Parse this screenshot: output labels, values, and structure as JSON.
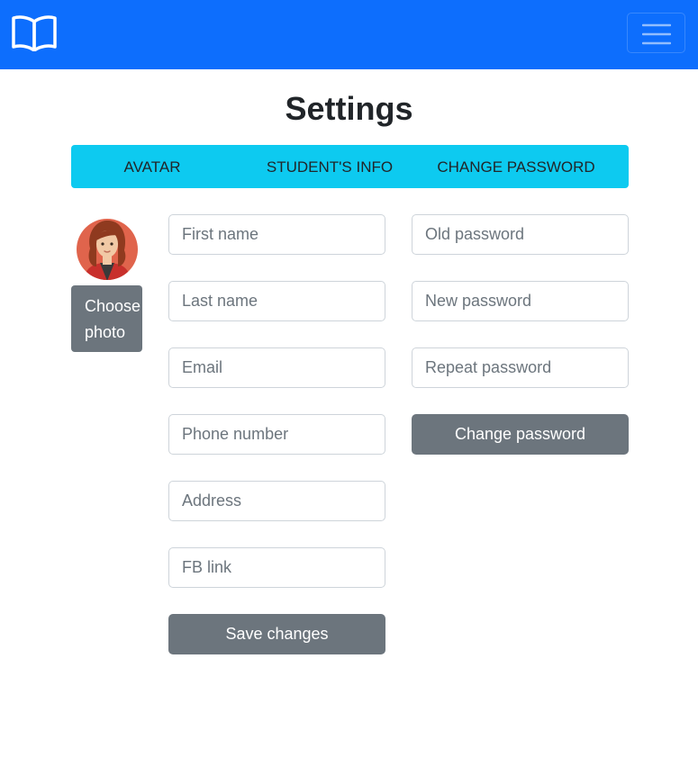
{
  "navbar": {
    "brand_icon": "book-open-icon",
    "menu_icon": "hamburger-menu-icon",
    "color": "#0d6efd"
  },
  "page": {
    "title": "Settings"
  },
  "tabs": {
    "color": "#0dcaf0",
    "items": [
      {
        "label": "AVATAR"
      },
      {
        "label": "STUDENT'S INFO"
      },
      {
        "label": "CHANGE PASSWORD"
      }
    ]
  },
  "avatar": {
    "icon": "user-avatar-icon",
    "choose_label": "Choose photo"
  },
  "info_form": {
    "first_name": {
      "placeholder": "First name",
      "value": ""
    },
    "last_name": {
      "placeholder": "Last name",
      "value": ""
    },
    "email": {
      "placeholder": "Email",
      "value": ""
    },
    "phone": {
      "placeholder": "Phone number",
      "value": ""
    },
    "address": {
      "placeholder": "Address",
      "value": ""
    },
    "fb_link": {
      "placeholder": "FB link",
      "value": ""
    },
    "save_label": "Save changes"
  },
  "password_form": {
    "old_password": {
      "placeholder": "Old password",
      "value": ""
    },
    "new_password": {
      "placeholder": "New password",
      "value": ""
    },
    "repeat_password": {
      "placeholder": "Repeat password",
      "value": ""
    },
    "change_label": "Change password"
  },
  "colors": {
    "secondary_button": "#6c757d",
    "input_border": "#ced4da"
  }
}
